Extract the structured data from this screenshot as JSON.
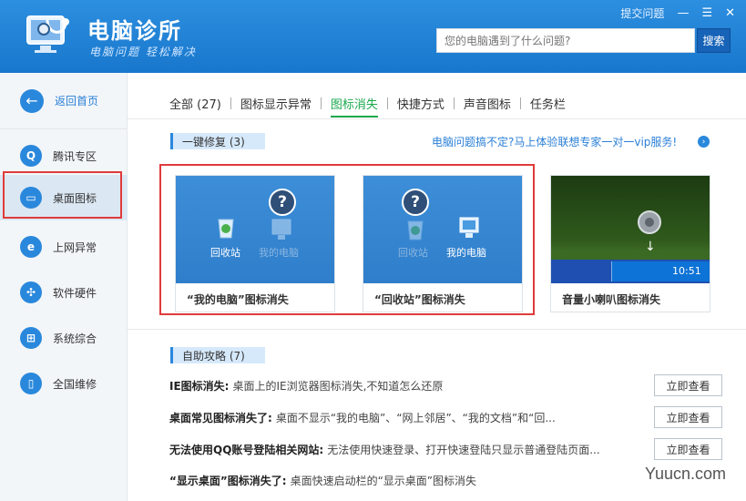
{
  "app": {
    "title": "电脑诊所",
    "slogan": "电脑问题 轻松解决",
    "top_links": {
      "feedback": "提交问题",
      "minimize": "—",
      "maximize": "☰",
      "close": "✕"
    },
    "search": {
      "placeholder": "您的电脑遇到了什么问题?",
      "button": "搜索"
    }
  },
  "sidebar": {
    "back_home": "返回首页",
    "items": [
      {
        "label": "腾讯专区",
        "icon": "qq-penguin-icon",
        "active": false
      },
      {
        "label": "桌面图标",
        "icon": "desktop-monitor-icon",
        "active": true
      },
      {
        "label": "上网异常",
        "icon": "ie-browser-icon",
        "active": false
      },
      {
        "label": "软件硬件",
        "icon": "hardware-chip-icon",
        "active": false
      },
      {
        "label": "系统综合",
        "icon": "windows-logo-icon",
        "active": false
      },
      {
        "label": "全国维修",
        "icon": "phone-repair-icon",
        "active": false
      }
    ]
  },
  "tabs": [
    {
      "label": "全部 (27)",
      "active": false
    },
    {
      "label": "图标显示异常",
      "active": false
    },
    {
      "label": "图标消失",
      "active": true
    },
    {
      "label": "快捷方式",
      "active": false
    },
    {
      "label": "声音图标",
      "active": false
    },
    {
      "label": "任务栏",
      "active": false
    }
  ],
  "quick_fix": {
    "header": "一键修复 (3)",
    "promo": "电脑问题搞不定?马上体验联想专家一对一vip服务!",
    "cards": [
      {
        "title": "“我的电脑”图标消失",
        "icon_a": "回收站",
        "icon_b": "我的电脑"
      },
      {
        "title": "“回收站”图标消失",
        "icon_a": "回收站",
        "icon_b": "我的电脑"
      },
      {
        "title": "音量小喇叭图标消失",
        "clock": "10:51"
      }
    ]
  },
  "guides": {
    "header": "自助攻略 (7)",
    "view_label": "立即查看",
    "items": [
      {
        "title": "IE图标消失:",
        "desc": "桌面上的IE浏览器图标消失,不知道怎么还原"
      },
      {
        "title": "桌面常见图标消失了:",
        "desc": "桌面不显示“我的电脑”、“网上邻居”、“我的文档”和“回..."
      },
      {
        "title": "无法使用QQ账号登陆相关网站:",
        "desc": "无法使用快速登录、打开快速登陆只显示普通登陆页面..."
      },
      {
        "title": "“显示桌面”图标消失了:",
        "desc": "桌面快速启动栏的“显示桌面”图标消失"
      }
    ]
  },
  "watermark": "Yuucn.com",
  "colors": {
    "header_blue": "#1877cc",
    "accent_green": "#1aa84c",
    "highlight_red": "#e03b3b"
  }
}
